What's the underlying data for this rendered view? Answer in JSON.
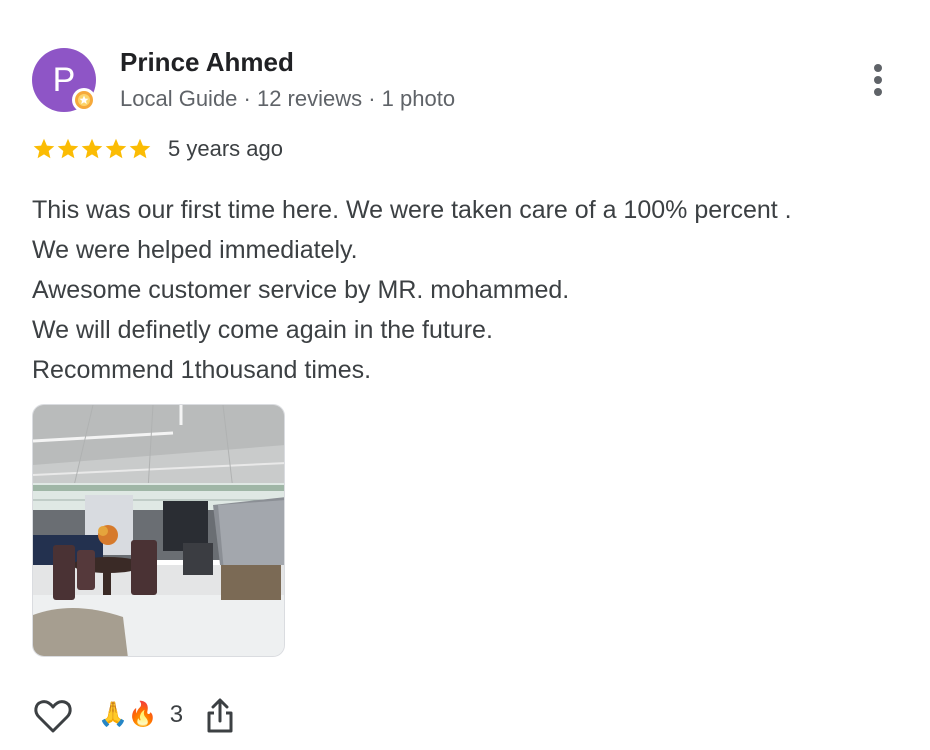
{
  "reviewer": {
    "initial": "P",
    "name": "Prince Ahmed",
    "meta": "Local Guide · 12 reviews · 1 photo",
    "avatar_color": "#8e55c6"
  },
  "review": {
    "rating": 5,
    "max_rating": 5,
    "time_ago": "5 years ago",
    "text_lines": [
      "This was our first time here. We were taken care of a 100% percent .",
      "We were helped immediately.",
      "Awesome customer service by MR. mohammed.",
      "We will definetly come again in the future.",
      "Recommend 1thousand times."
    ],
    "photo_count": 1
  },
  "actions": {
    "reactions_emoji": "🙏🔥",
    "reactions_count": "3"
  },
  "icons": {
    "more": "more-vert-icon",
    "like": "heart-outline-icon",
    "share": "share-icon",
    "badge": "local-guide-badge-icon",
    "star": "star-icon"
  },
  "colors": {
    "star": "#fbbc04",
    "text": "#3c4043",
    "secondary": "#5f6368"
  }
}
